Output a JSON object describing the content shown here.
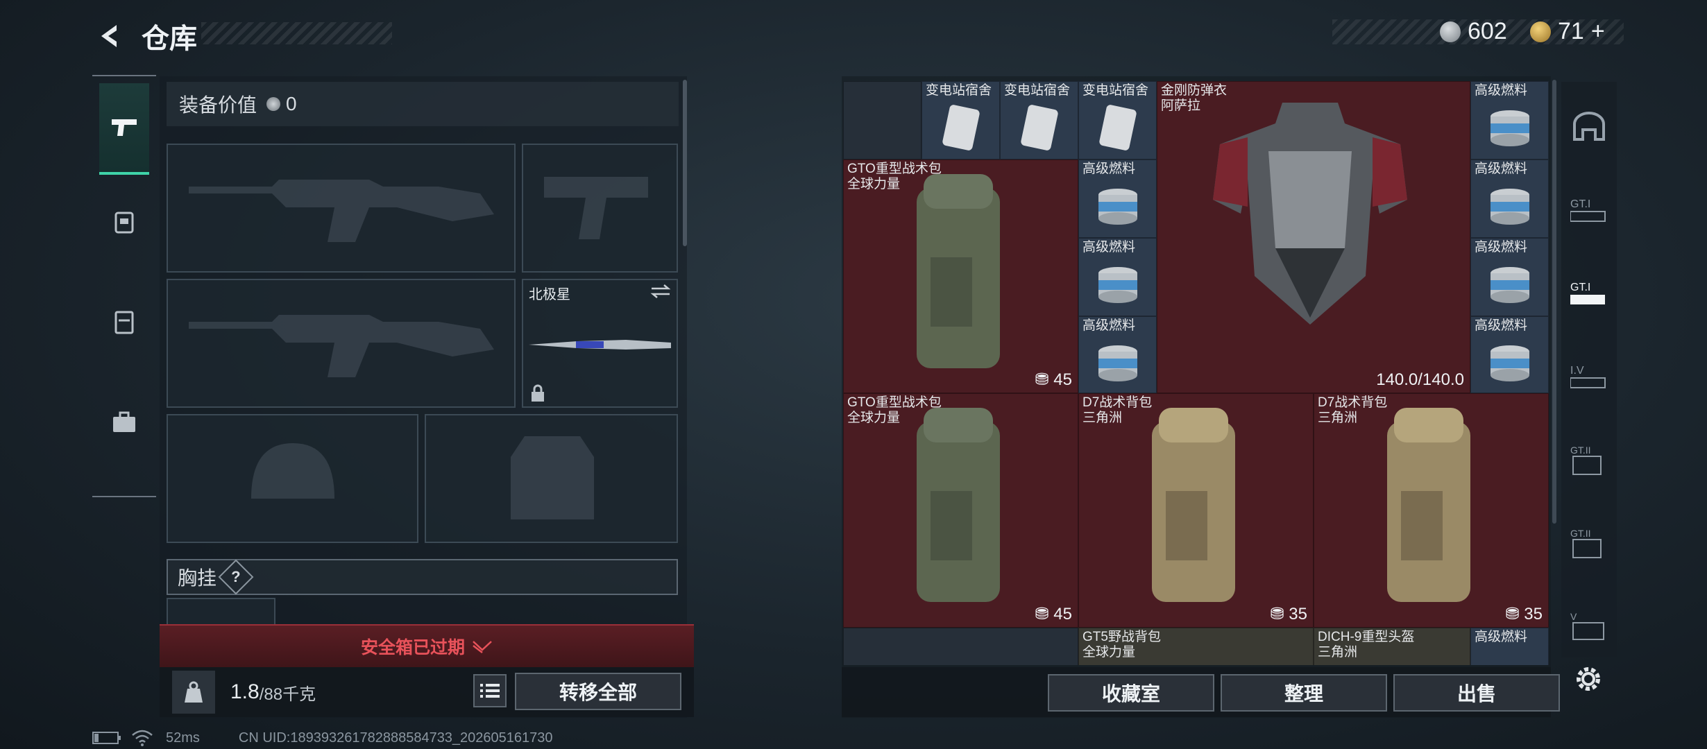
{
  "header": {
    "title": "仓库",
    "currency": [
      {
        "icon": "silver-coin-icon",
        "value": "602"
      },
      {
        "icon": "gold-coin-icon",
        "value": "71"
      },
      {
        "icon": "plus-icon",
        "value": "+"
      }
    ]
  },
  "equipment": {
    "value_label": "装备价值",
    "value": "0",
    "melee_slot_name": "北极星",
    "chest_rig_label": "胸挂",
    "help": "?",
    "safebox_expired": "安全箱已过期",
    "weight_current": "1.8",
    "weight_max": "/88千克",
    "transfer_all": "转移全部"
  },
  "storage": {
    "top_items": [
      {
        "name": "变电站宿舍"
      },
      {
        "name": "变电站宿舍"
      },
      {
        "name": "变电站宿舍"
      }
    ],
    "armor": {
      "name_line1": "金刚防弹衣",
      "name_line2": "阿萨拉",
      "durability": "140.0/140.0"
    },
    "fuel_label": "高级燃料",
    "bag1": {
      "name_line1": "GTO重型战术包",
      "name_line2": "全球力量",
      "count": "45"
    },
    "bag2": {
      "name_line1": "GTO重型战术包",
      "name_line2": "全球力量",
      "count": "45"
    },
    "bag3": {
      "name_line1": "D7战术背包",
      "name_line2": "三角洲",
      "count": "35"
    },
    "bag4": {
      "name_line1": "D7战术背包",
      "name_line2": "三角洲",
      "count": "35"
    },
    "bag5": {
      "name_line1": "GT5野战背包",
      "name_line2": "全球力量"
    },
    "helmet": {
      "name_line1": "DICH-9重型头盔",
      "name_line2": "三角洲"
    },
    "buttons": {
      "collection": "收藏室",
      "organize": "整理",
      "sell": "出售"
    }
  },
  "side_tabs": [
    "home-vault-icon",
    "gt-i-icon",
    "gt-i-selected-icon",
    "iv-icon",
    "gt-ii-icon",
    "gt-ii-b-icon",
    "v-icon"
  ],
  "status": {
    "ping": "52ms",
    "uid": "CN UID:189393261782888584733_202605161730"
  },
  "colors": {
    "accent": "#3fd3a8",
    "expired": "#e8525a",
    "cell_red": "#4a1c22",
    "cell_blue": "#2d3b4d"
  }
}
